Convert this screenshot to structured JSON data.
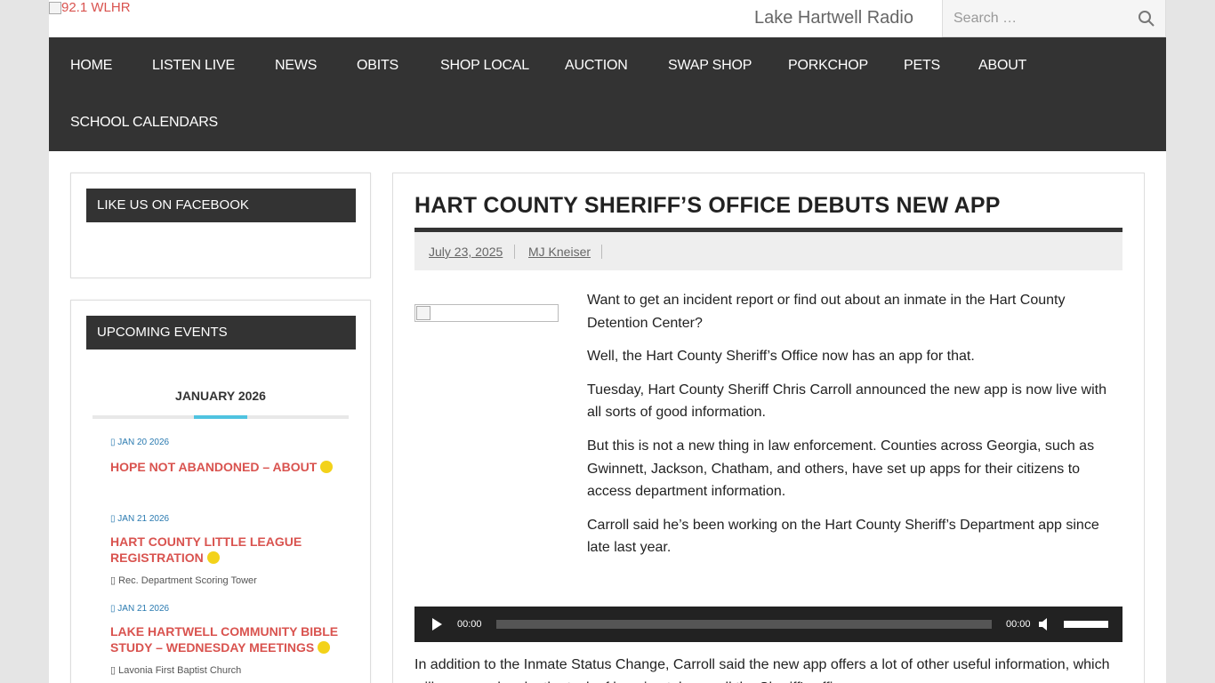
{
  "header": {
    "logo_alt": "92.1 WLHR",
    "site_title": "Lake Hartwell Radio",
    "search_placeholder": "Search …"
  },
  "nav": {
    "items": [
      "HOME",
      "LISTEN LIVE",
      "NEWS",
      "OBITS",
      "SHOP LOCAL",
      "AUCTION",
      "SWAP SHOP",
      "PORKCHOP",
      "PETS",
      "ABOUT",
      "SCHOOL CALENDARS"
    ]
  },
  "sidebar": {
    "facebook_title": "LIKE US ON FACEBOOK",
    "events_title": "UPCOMING EVENTS",
    "calendar_month": "JANUARY 2026",
    "events": [
      {
        "date": "JAN 20 2026",
        "title": "HOPE NOT ABANDONED – ABOUT",
        "location": ""
      },
      {
        "date": "JAN 21 2026",
        "title": "HART COUNTY LITTLE LEAGUE REGISTRATION",
        "location": "Rec. Department Scoring Tower"
      },
      {
        "date": "JAN 21 2026",
        "title": "LAKE HARTWELL COMMUNITY BIBLE STUDY – WEDNESDAY MEETINGS",
        "location": "Lavonia First Baptist Church"
      }
    ]
  },
  "article": {
    "title": "HART COUNTY SHERIFF’S OFFICE DEBUTS NEW APP",
    "date": "July 23, 2025",
    "author": "MJ Kneiser",
    "paragraphs": [
      "Want to get an incident report or find out about an inmate in the Hart County Detention Center?",
      "Well, the Hart County Sheriff’s Office now has an app for that.",
      "Tuesday, Hart County Sheriff Chris Carroll announced the new app is now live with all sorts of good information.",
      "But this is not a new thing in law enforcement. Counties across Georgia, such as Gwinnett, Jackson, Chatham, and others, have set up apps for their citizens to access department information.",
      "Carroll said he’s been working on the Hart County Sheriff’s Department app since late last year."
    ],
    "audio": {
      "current_time": "00:00",
      "duration": "00:00"
    },
    "after_audio": "In addition to the Inmate Status Change, Carroll said the new app offers a lot of other useful information, which will serve and make the task of keeping tabs on all the Sheriff's office..."
  },
  "colors": {
    "nav_bg": "#333333",
    "event_title": "#d9534f",
    "event_date": "#2a7ab0",
    "accent_bar": "#4fc3e0",
    "event_dot": "#f3d21a"
  }
}
